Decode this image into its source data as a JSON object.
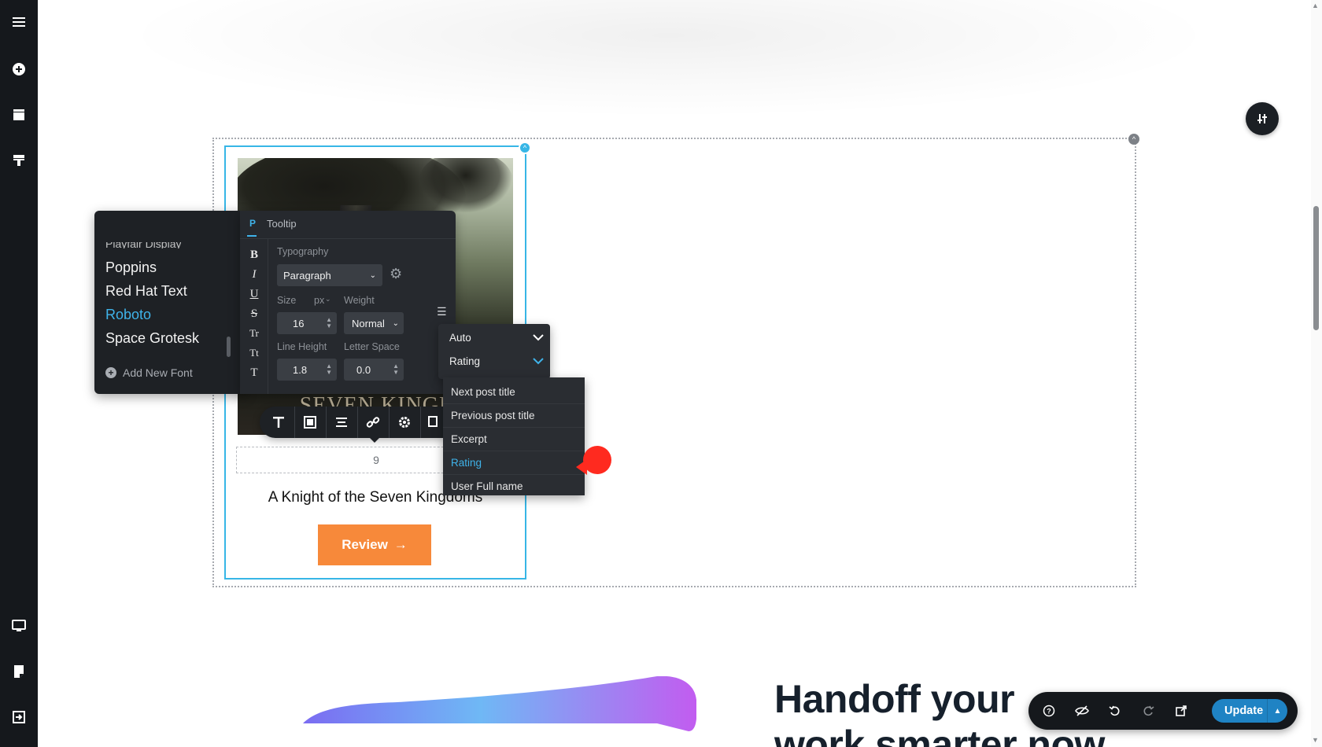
{
  "sidebar": {
    "top_icons": [
      "menu-icon",
      "add-circle-icon",
      "layout-icon",
      "brush-icon"
    ],
    "bottom_icons": [
      "desktop-icon",
      "page-icon",
      "exit-icon"
    ]
  },
  "card": {
    "cover_title": "KNIGHT OF THE SEVEN KINGD",
    "rating_value": "9",
    "book_title": "A Knight of the Seven Kingdoms",
    "review_label": "Review",
    "review_arrow": "→"
  },
  "font_panel": {
    "clipped_item": "Playfair Display",
    "fonts": [
      "Poppins",
      "Red Hat Text",
      "Roboto",
      "Space Grotesk"
    ],
    "active_font": "Roboto",
    "add_font_label": "Add New Font"
  },
  "typography": {
    "tag": "P",
    "element_name": "Tooltip",
    "section_label": "Typography",
    "format_buttons": [
      "B",
      "I",
      "U",
      "S",
      "Tr",
      "Tt",
      "T"
    ],
    "tag_select": "Paragraph",
    "size_label": "Size",
    "unit_label": "px",
    "weight_label": "Weight",
    "size_value": "16",
    "weight_value": "Normal",
    "line_height_label": "Line Height",
    "letter_space_label": "Letter Space",
    "line_height_value": "1.8",
    "letter_space_value": "0.0"
  },
  "source": {
    "mode": "Auto",
    "field": "Rating",
    "options": [
      "Next post title",
      "Previous post title",
      "Excerpt",
      "Rating",
      "User Full name"
    ],
    "active_option": "Rating"
  },
  "toolbar_icons": [
    "text-icon",
    "block-icon",
    "align-icon",
    "link-icon",
    "settings-icon",
    "copy-icon"
  ],
  "bottom_section": {
    "heading_line1": "Handoff your",
    "heading_line2": "work smarter now"
  },
  "bottom_bar": {
    "icons": [
      "help-icon",
      "visibility-icon",
      "undo-icon",
      "redo-icon",
      "external-link-icon"
    ],
    "update_label": "Update"
  },
  "colors": {
    "accent": "#37b6e6",
    "review_button": "#f7893a",
    "update_button": "#1f83c4",
    "dark_panel": "#1e2125"
  }
}
